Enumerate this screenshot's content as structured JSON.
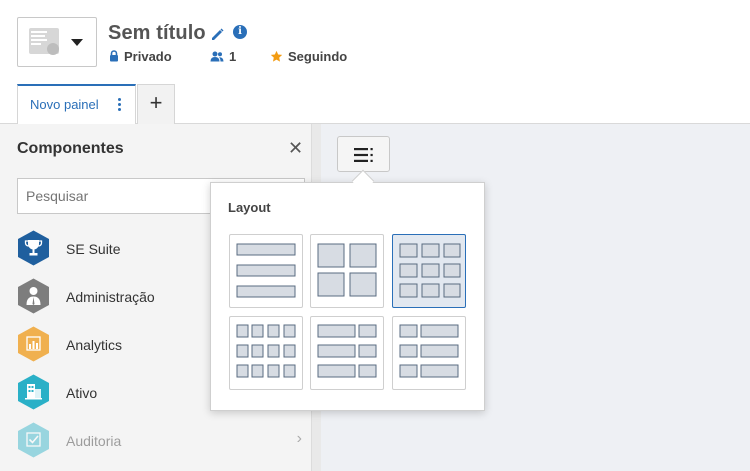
{
  "header": {
    "title": "Sem título",
    "privacy": "Privado",
    "members_count": "1",
    "follow_label": "Seguindo"
  },
  "tabs": [
    {
      "label": "Novo painel"
    }
  ],
  "add_tab_label": "+",
  "sidebar": {
    "title": "Componentes",
    "close_glyph": "✕",
    "search_placeholder": "Pesquisar",
    "items": [
      {
        "label": "SE Suite",
        "icon": "trophy-icon",
        "color": "#1f5f9e"
      },
      {
        "label": "Administração",
        "icon": "user-admin-icon",
        "color": "#7d7d7d"
      },
      {
        "label": "Analytics",
        "icon": "chart-icon",
        "color": "#f0b04f"
      },
      {
        "label": "Ativo",
        "icon": "building-icon",
        "color": "#2ab0c7"
      },
      {
        "label": "Auditoria",
        "icon": "audit-icon",
        "color": "#2ab0c7"
      }
    ],
    "chevron_glyph": "›"
  },
  "layout_popover": {
    "title": "Layout",
    "options": [
      {
        "name": "three-rows"
      },
      {
        "name": "two-by-two"
      },
      {
        "name": "three-by-three",
        "selected": true
      },
      {
        "name": "four-by-four"
      },
      {
        "name": "wide-left-narrow-right"
      },
      {
        "name": "narrow-left-wide-right"
      }
    ]
  },
  "colors": {
    "accent": "#2a6fb8",
    "star": "#f39c12"
  }
}
